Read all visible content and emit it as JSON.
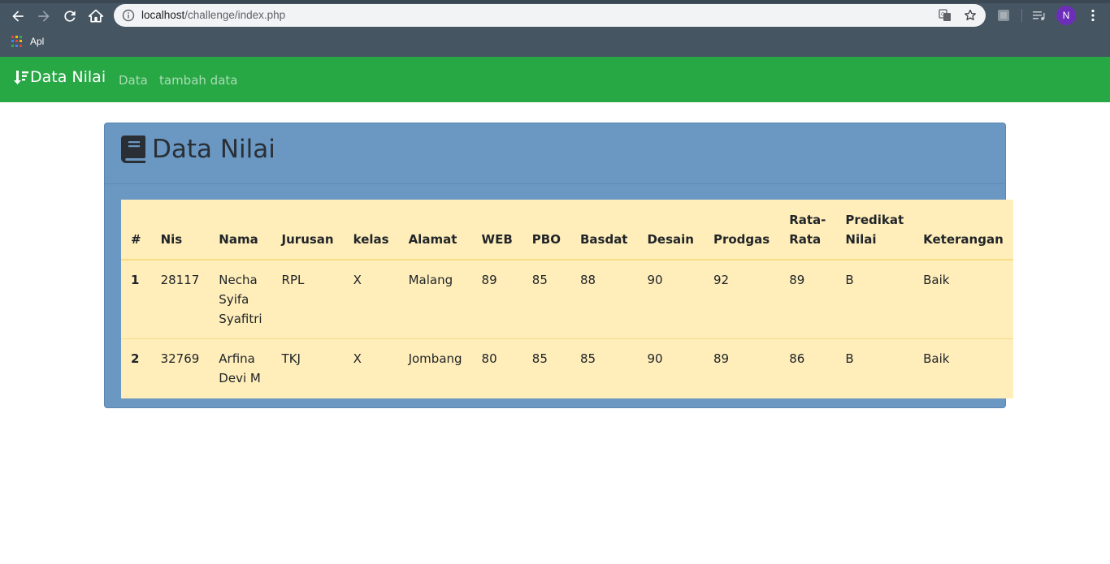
{
  "browser": {
    "url_host": "localhost",
    "url_path": "/challenge/index.php",
    "bookmarks_label": "Apl",
    "profile_initial": "N",
    "colors": {
      "frame": "#465562",
      "omnibox": "#f1f3f4",
      "profile": "#6c2eb9"
    }
  },
  "navbar": {
    "brand": "Data Nilai",
    "links": [
      "Data",
      "tambah data"
    ],
    "color": "#28a745"
  },
  "card": {
    "title": "Data Nilai",
    "color": "#6a98c3"
  },
  "table": {
    "headers": [
      "#",
      "Nis",
      "Nama",
      "Jurusan",
      "kelas",
      "Alamat",
      "WEB",
      "PBO",
      "Basdat",
      "Desain",
      "Prodgas",
      "Rata-Rata",
      "Predikat Nilai",
      "Keterangan"
    ],
    "rows": [
      [
        "1",
        "28117",
        "Necha Syifa Syafitri",
        "RPL",
        "X",
        "Malang",
        "89",
        "85",
        "88",
        "90",
        "92",
        "89",
        "B",
        "Baik"
      ],
      [
        "2",
        "32769",
        "Arfina Devi M",
        "TKJ",
        "X",
        "Jombang",
        "80",
        "85",
        "85",
        "90",
        "89",
        "86",
        "B",
        "Baik"
      ]
    ],
    "color": "#ffeeba"
  }
}
